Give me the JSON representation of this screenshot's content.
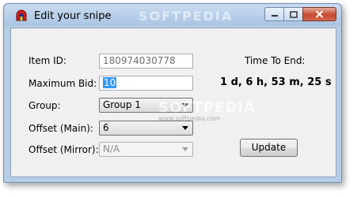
{
  "window": {
    "title": "Edit your snipe",
    "watermark": "SOFTPEDIA"
  },
  "form": {
    "item_id_label": "Item ID:",
    "item_id_value": "180974030778",
    "max_bid_label": "Maximum Bid:",
    "max_bid_value": "10",
    "group_label": "Group:",
    "group_value": "Group 1",
    "offset_main_label": "Offset (Main):",
    "offset_main_value": "6",
    "offset_mirror_label": "Offset (Mirror):",
    "offset_mirror_value": "N/A"
  },
  "timer": {
    "label": "Time To End:",
    "value": "1 d, 6 h, 53 m, 25 s"
  },
  "actions": {
    "update_label": "Update"
  },
  "overlay": {
    "watermark": "SOFTPEDIA",
    "url": "www.softpedia.com"
  },
  "icons": {
    "app": "app-icon",
    "minimize": "minimize-icon",
    "maximize": "maximize-icon",
    "close": "close-icon",
    "dropdown": "chevron-down-icon"
  },
  "colors": {
    "selection": "#3399ff",
    "close_button": "#c7492f"
  }
}
